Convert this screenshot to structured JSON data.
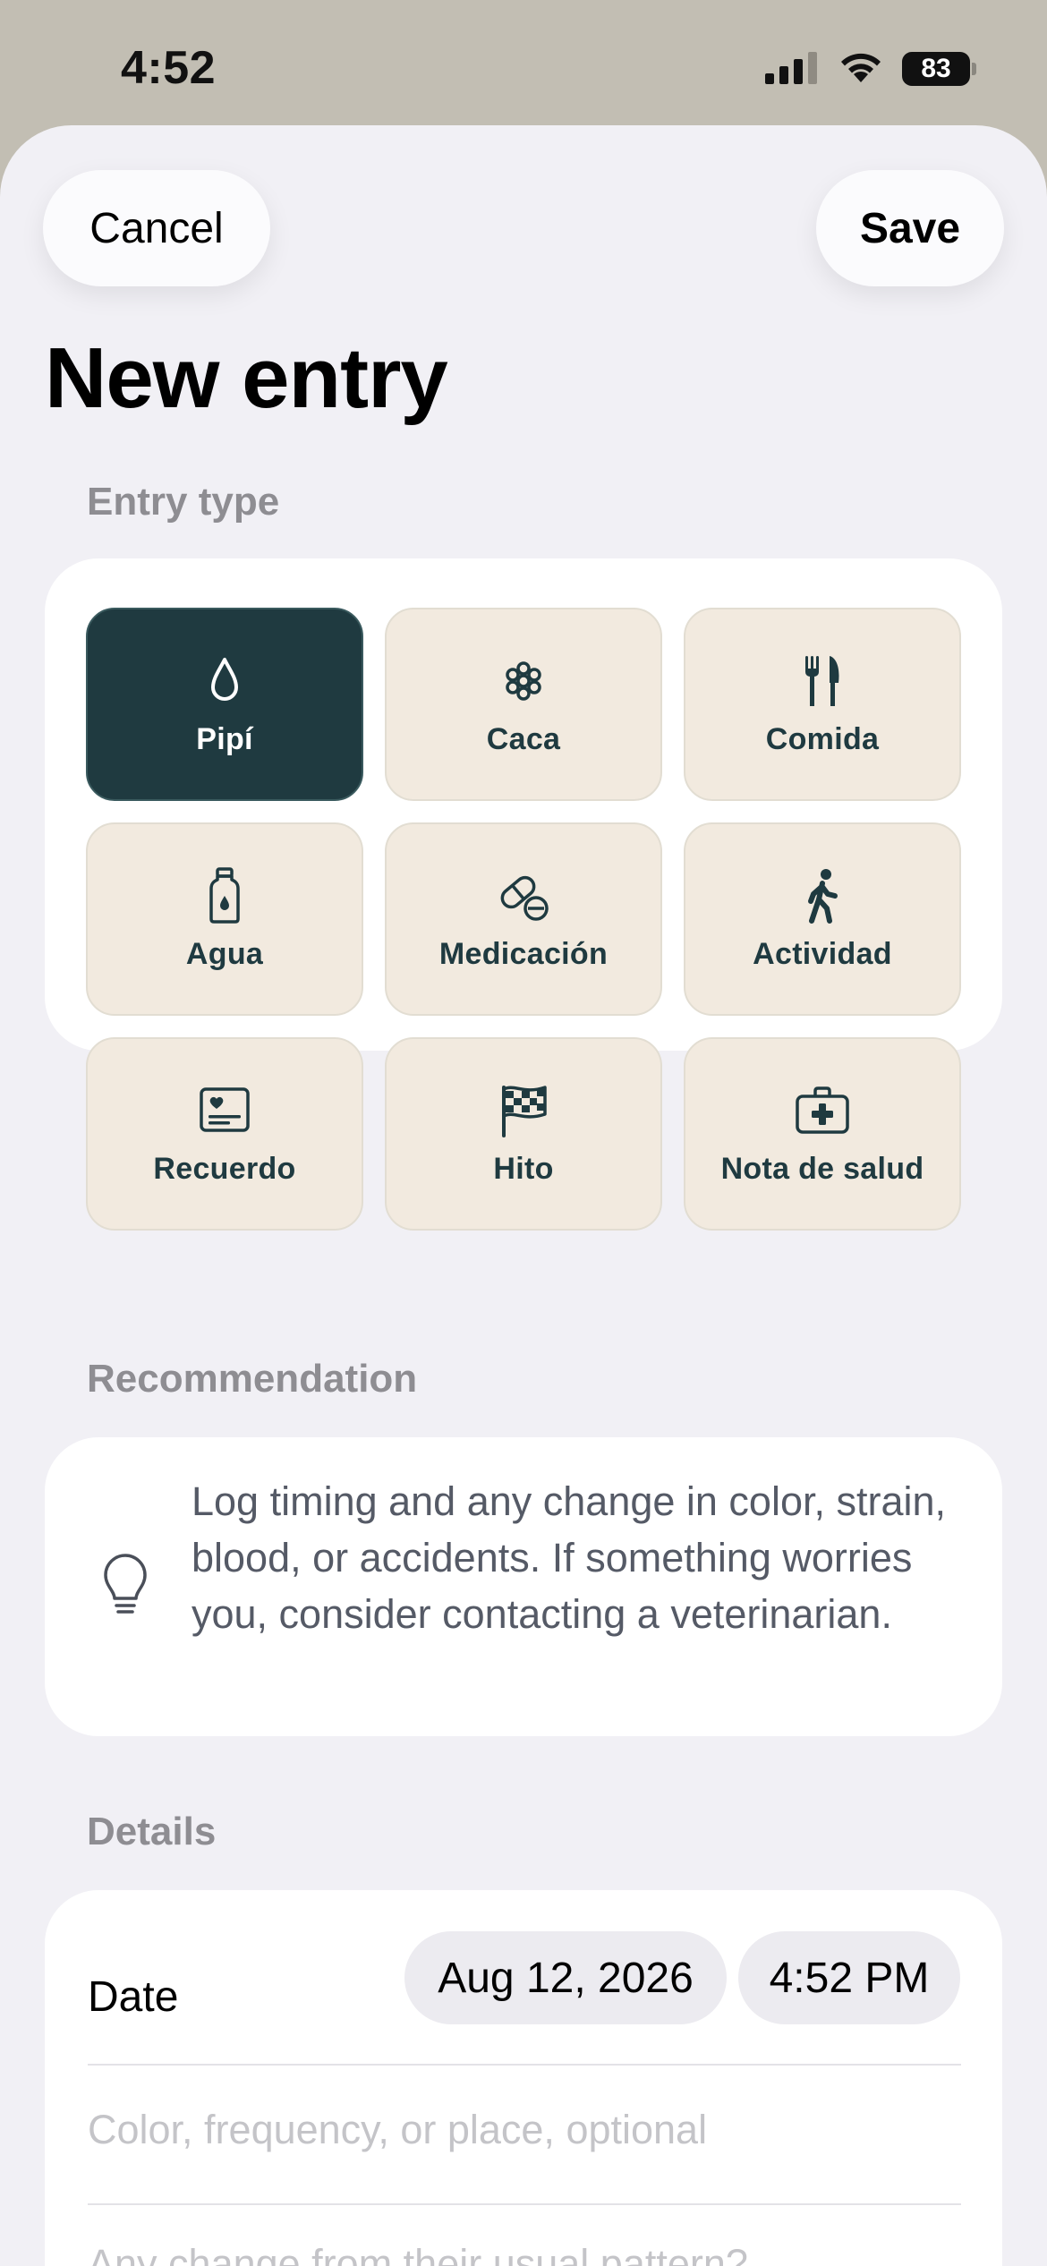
{
  "status_bar": {
    "time": "4:52",
    "battery": "83"
  },
  "header": {
    "cancel_label": "Cancel",
    "save_label": "Save",
    "title": "New entry"
  },
  "entry_type": {
    "section_label": "Entry type",
    "selected": "Pipí",
    "options": [
      {
        "label": "Pipí",
        "icon": "droplet-icon"
      },
      {
        "label": "Caca",
        "icon": "poop-dots-icon"
      },
      {
        "label": "Comida",
        "icon": "fork-knife-icon"
      },
      {
        "label": "Agua",
        "icon": "water-bottle-icon"
      },
      {
        "label": "Medicación",
        "icon": "pills-icon"
      },
      {
        "label": "Actividad",
        "icon": "walking-figure-icon"
      },
      {
        "label": "Recuerdo",
        "icon": "memory-card-heart-icon"
      },
      {
        "label": "Hito",
        "icon": "checkered-flag-icon"
      },
      {
        "label": "Nota de salud",
        "icon": "medical-kit-icon"
      }
    ]
  },
  "recommendation": {
    "section_label": "Recommendation",
    "icon": "lightbulb-icon",
    "text": "Log timing and any change in color, strain, blood, or accidents. If something worries you, consider contacting a veterinarian."
  },
  "details": {
    "section_label": "Details",
    "date_label": "Date",
    "date_value": "Aug 12, 2026",
    "time_value": "4:52 PM",
    "field1_placeholder": "Color, frequency, or place, optional",
    "field2_placeholder": "Any change from their usual pattern?"
  },
  "colors": {
    "accent": "#1f3a40",
    "tile_bg": "#f2eadf",
    "sheet_bg": "#f1f0f5"
  }
}
